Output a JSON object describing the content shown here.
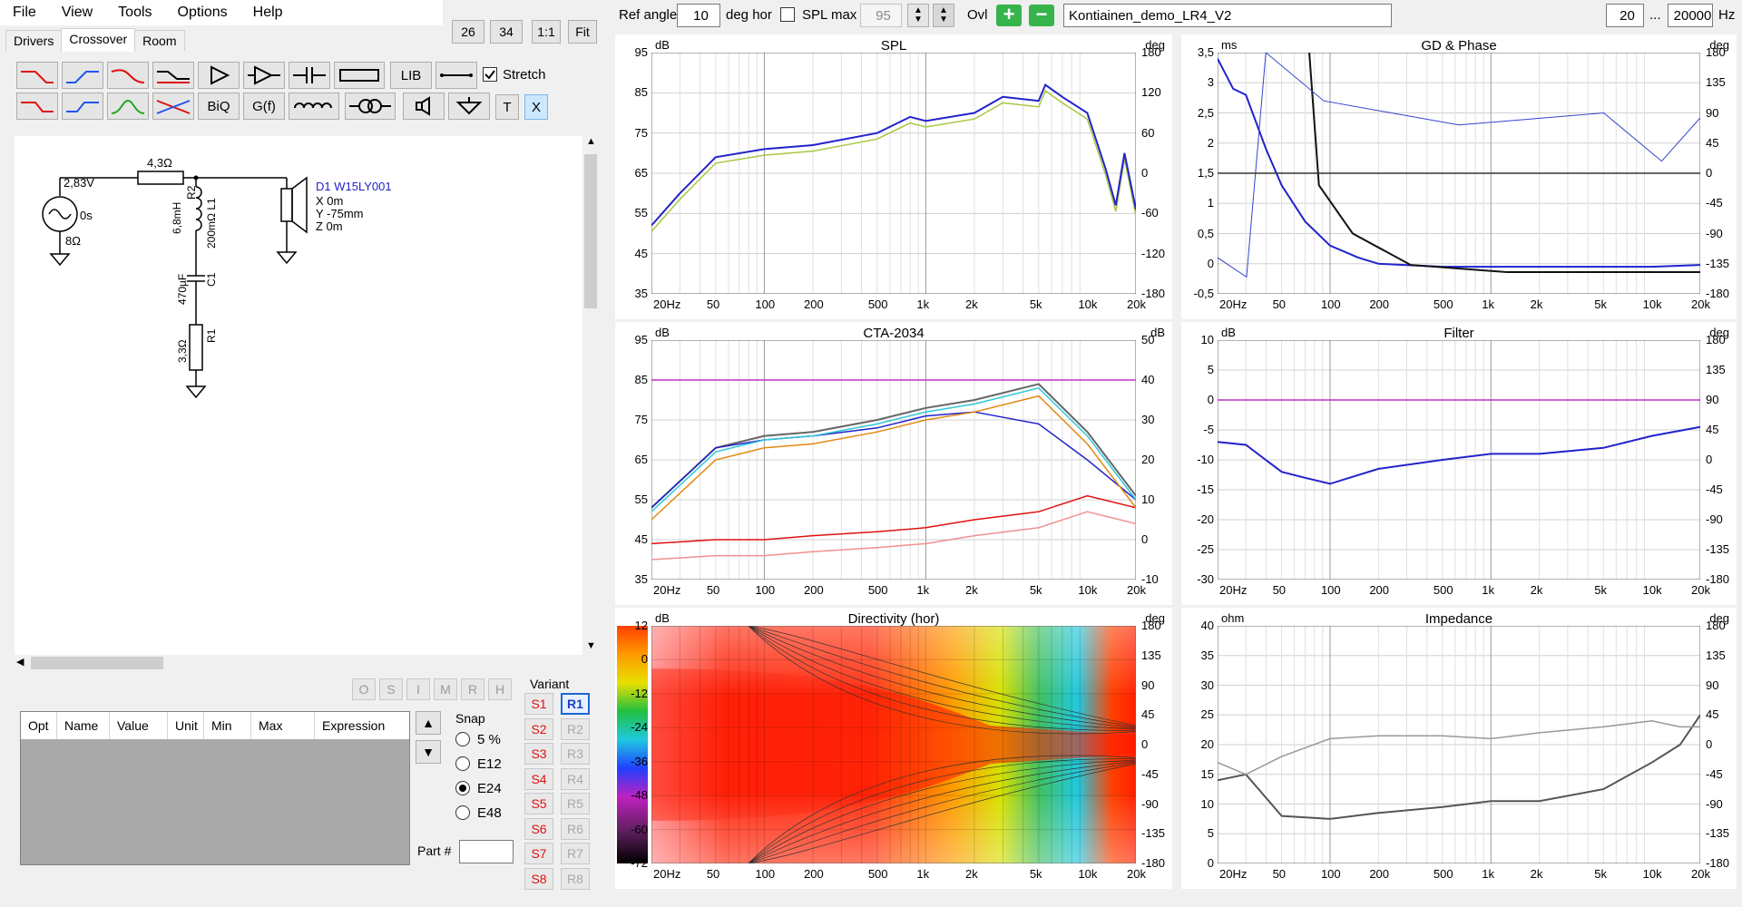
{
  "menu": [
    "File",
    "View",
    "Tools",
    "Options",
    "Help"
  ],
  "tabs": [
    "Drivers",
    "Crossover",
    "Room"
  ],
  "view_buttons": [
    "26",
    "34",
    "1:1",
    "Fit"
  ],
  "toolbar": {
    "lib": "LIB",
    "biq": "BiQ",
    "gf": "G(f)",
    "t": "T",
    "x": "X",
    "stretch": "Stretch"
  },
  "schematic": {
    "source_v": "2,83V",
    "source_phase": "0s",
    "source_r": "8Ω",
    "r_series": "4,3Ω",
    "r2_val": "6,8mH",
    "r2_name": "R2",
    "l1_val": "200mΩ L1",
    "c1_name": "C1",
    "c1_val": "470µF",
    "r1_val": "3,3Ω",
    "r1_name": "R1",
    "driver_name": "D1 W15LY001",
    "driver_x": "X 0m",
    "driver_y": "Y -75mm",
    "driver_z": "Z 0m"
  },
  "opt_buttons": [
    "O",
    "S",
    "I",
    "M",
    "R",
    "H"
  ],
  "table_headers": [
    "Opt",
    "Name",
    "Value",
    "Unit",
    "Min",
    "Max",
    "Expression"
  ],
  "snap": {
    "label": "Snap",
    "options": [
      "5 %",
      "E12",
      "E24",
      "E48"
    ],
    "selected": "E24"
  },
  "part_label": "Part #",
  "variant": {
    "label": "Variant",
    "s": [
      "S1",
      "S2",
      "S3",
      "S4",
      "S5",
      "S6",
      "S7",
      "S8"
    ],
    "r": [
      "R1",
      "R2",
      "R3",
      "R4",
      "R5",
      "R6",
      "R7",
      "R8"
    ],
    "active": "R1"
  },
  "top": {
    "ref_angle_label": "Ref angle",
    "ref_angle": "10",
    "deg_hor": "deg hor",
    "spl_max_label": "SPL max",
    "spl_max": "95",
    "ovl": "Ovl",
    "project": "Kontiainen_demo_LR4_V2",
    "f_low": "20",
    "f_sep": "...",
    "f_high": "20000",
    "hz": "Hz"
  },
  "colors": {
    "green_btn": "#36b34a",
    "magenta": "#c030c0",
    "blue": "#2222cc",
    "red": "#e01010",
    "orange": "#e08a10"
  },
  "freq_ticks": [
    "20Hz",
    "50",
    "100",
    "200",
    "500",
    "1k",
    "2k",
    "5k",
    "10k",
    "20k"
  ],
  "charts": [
    {
      "title": "SPL",
      "unitL": "dB",
      "unitR": "deg",
      "left": [
        "95",
        "85",
        "75",
        "65",
        "55",
        "45",
        "35"
      ],
      "right": [
        "180",
        "120",
        "60",
        "0",
        "-60",
        "-120",
        "-180"
      ]
    },
    {
      "title": "GD & Phase",
      "unitL": "ms",
      "unitR": "deg",
      "left": [
        "3,5",
        "3",
        "2,5",
        "2",
        "1,5",
        "1",
        "0,5",
        "0",
        "-0,5"
      ],
      "right": [
        "180",
        "135",
        "90",
        "45",
        "0",
        "-45",
        "-90",
        "-135",
        "-180"
      ]
    },
    {
      "title": "CTA-2034",
      "unitL": "dB",
      "unitR": "dB",
      "left": [
        "95",
        "85",
        "75",
        "65",
        "55",
        "45",
        "35"
      ],
      "right": [
        "50",
        "40",
        "30",
        "20",
        "10",
        "0",
        "-10"
      ]
    },
    {
      "title": "Filter",
      "unitL": "dB",
      "unitR": "deg",
      "left": [
        "10",
        "5",
        "0",
        "-5",
        "-10",
        "-15",
        "-20",
        "-25",
        "-30"
      ],
      "right": [
        "180",
        "135",
        "90",
        "45",
        "0",
        "-45",
        "-90",
        "-135",
        "-180"
      ]
    },
    {
      "title": "Directivity (hor)",
      "unitL": "dB",
      "unitR": "deg",
      "left": [
        "12",
        "0",
        "-12",
        "-24",
        "-36",
        "-48",
        "-60",
        "-72"
      ],
      "right": [
        "180",
        "135",
        "90",
        "45",
        "0",
        "-45",
        "-90",
        "-135",
        "-180"
      ]
    },
    {
      "title": "Impedance",
      "unitL": "ohm",
      "unitR": "deg",
      "left": [
        "40",
        "35",
        "30",
        "25",
        "20",
        "15",
        "10",
        "5",
        "0"
      ],
      "right": [
        "180",
        "135",
        "90",
        "45",
        "0",
        "-45",
        "-90",
        "-135",
        "-180"
      ]
    }
  ],
  "chart_data": [
    {
      "type": "line",
      "title": "SPL",
      "x": [
        20,
        30,
        50,
        100,
        200,
        500,
        800,
        1000,
        2000,
        3000,
        5000,
        5500,
        7000,
        10000,
        13000,
        15000,
        17000,
        20000
      ],
      "series": [
        {
          "values": [
            52,
            60,
            69,
            71,
            72,
            75,
            79,
            78,
            80,
            84,
            83,
            87,
            84,
            80,
            66,
            57,
            70,
            56
          ]
        }
      ],
      "ylim": [
        35,
        95
      ]
    },
    {
      "type": "line",
      "title": "GD & Phase",
      "x": [
        20,
        25,
        30,
        40,
        50,
        70,
        100,
        150,
        200,
        500,
        1000,
        2000,
        5000,
        10000,
        20000
      ],
      "series": [
        {
          "values": [
            3.4,
            2.9,
            2.8,
            1.9,
            1.3,
            0.7,
            0.3,
            0.1,
            0.0,
            -0.05,
            -0.05,
            -0.05,
            -0.05,
            -0.05,
            -0.02
          ]
        }
      ],
      "ylim": [
        -0.5,
        3.5
      ]
    },
    {
      "type": "line",
      "title": "CTA-2034",
      "x": [
        20,
        50,
        100,
        200,
        500,
        1000,
        2000,
        5000,
        10000,
        20000
      ],
      "series": [
        {
          "values": [
            53,
            68,
            71,
            72,
            75,
            78,
            80,
            84,
            72,
            56
          ]
        },
        {
          "values": [
            53,
            68,
            70,
            71,
            73,
            76,
            77,
            74,
            65,
            55
          ]
        },
        {
          "values": [
            44,
            45,
            45,
            46,
            47,
            48,
            50,
            52,
            56,
            53
          ]
        },
        {
          "values": [
            85,
            85,
            85,
            85,
            85,
            85,
            85,
            85,
            85,
            85
          ]
        }
      ],
      "ylim": [
        35,
        95
      ]
    },
    {
      "type": "line",
      "title": "Filter",
      "x": [
        20,
        30,
        50,
        70,
        100,
        200,
        500,
        1000,
        2000,
        5000,
        10000,
        20000
      ],
      "series": [
        {
          "values": [
            -7,
            -7.5,
            -12,
            -13,
            -14,
            -11.5,
            -10,
            -9,
            -9,
            -8,
            -6,
            -4.5
          ]
        },
        {
          "values": [
            0,
            0,
            0,
            0,
            0,
            0,
            0,
            0,
            0,
            0,
            0,
            0
          ]
        }
      ],
      "ylim": [
        -30,
        10
      ]
    },
    {
      "type": "heatmap",
      "title": "Directivity (hor)",
      "ylim": [
        -180,
        180
      ]
    },
    {
      "type": "line",
      "title": "Impedance",
      "x": [
        20,
        30,
        50,
        100,
        200,
        500,
        1000,
        2000,
        5000,
        10000,
        15000,
        20000
      ],
      "series": [
        {
          "values": [
            14,
            15,
            8,
            7.5,
            8.5,
            9.5,
            10.5,
            10.5,
            12.5,
            17,
            20,
            25
          ]
        },
        {
          "values": [
            17,
            15,
            18,
            21,
            21.5,
            21.5,
            21,
            22,
            23,
            24,
            23,
            23
          ]
        }
      ],
      "ylim": [
        0,
        40
      ]
    }
  ]
}
